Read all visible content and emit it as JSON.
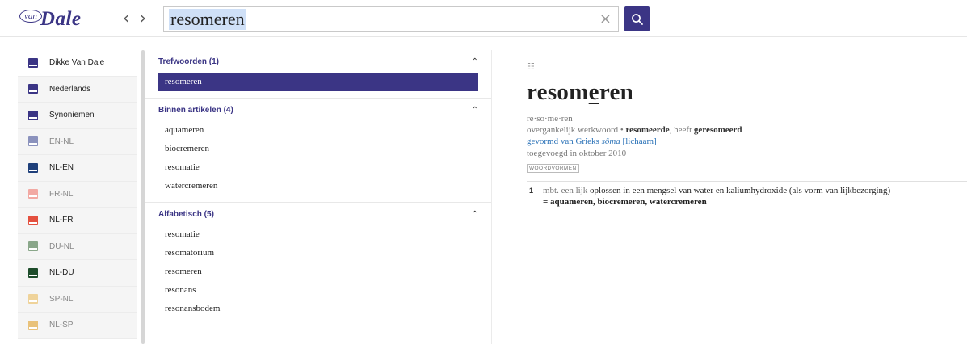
{
  "header": {
    "logo_van": "van",
    "logo_dale": "Dale",
    "back_glyph": "‹",
    "forward_glyph": "›",
    "search_value": "resomeren",
    "clear_glyph": "×"
  },
  "sidebar": {
    "items": [
      {
        "label": "Dikke Van Dale",
        "color": "#3b3585",
        "active": true
      },
      {
        "label": "Nederlands",
        "color": "#3b3585"
      },
      {
        "label": "Synoniemen",
        "color": "#3b3585"
      },
      {
        "label": "EN-NL",
        "color": "#8b92bd"
      },
      {
        "label": "NL-EN",
        "color": "#1e3f7a"
      },
      {
        "label": "FR-NL",
        "color": "#f2a9a3"
      },
      {
        "label": "NL-FR",
        "color": "#e4503f"
      },
      {
        "label": "DU-NL",
        "color": "#8aa78a"
      },
      {
        "label": "NL-DU",
        "color": "#1e4d2b"
      },
      {
        "label": "SP-NL",
        "color": "#efd39a"
      },
      {
        "label": "NL-SP",
        "color": "#e9c27a"
      }
    ]
  },
  "results": {
    "sections": [
      {
        "title": "Trefwoorden (1)",
        "items": [
          "resomeren"
        ]
      },
      {
        "title": "Binnen artikelen (4)",
        "items": [
          "aquameren",
          "biocremeren",
          "resomatie",
          "watercremeren"
        ]
      },
      {
        "title": "Alfabetisch (5)",
        "items": [
          "resomatie",
          "resomatorium",
          "resomeren",
          "resonans",
          "resonansbodem"
        ]
      }
    ]
  },
  "detail": {
    "headword_pre": "resom",
    "headword_stress": "e",
    "headword_post": "ren",
    "syllables": "re·so·me·ren",
    "gram_pre": "overgankelijk werkwoord • ",
    "gram_past": "resomeerde",
    "gram_mid": ", heeft ",
    "gram_pp": "geresomeerd",
    "origin_pre": "gevormd van Grieks ",
    "origin_word": "sôma",
    "origin_post": " [lichaam]",
    "added": "toegevoegd in oktober 2010",
    "wordforms_button": "WOORDVORMEN",
    "def_number": "1",
    "def_label": "mbt. een lijk",
    "def_text": " oplossen in een mengsel van water en kaliumhydroxide (als vorm van lijkbezorging)",
    "def_synonyms": "= aquameren, biocremeren, watercremeren"
  },
  "colors": {
    "brand": "#3b3585",
    "link": "#2c73b8"
  }
}
